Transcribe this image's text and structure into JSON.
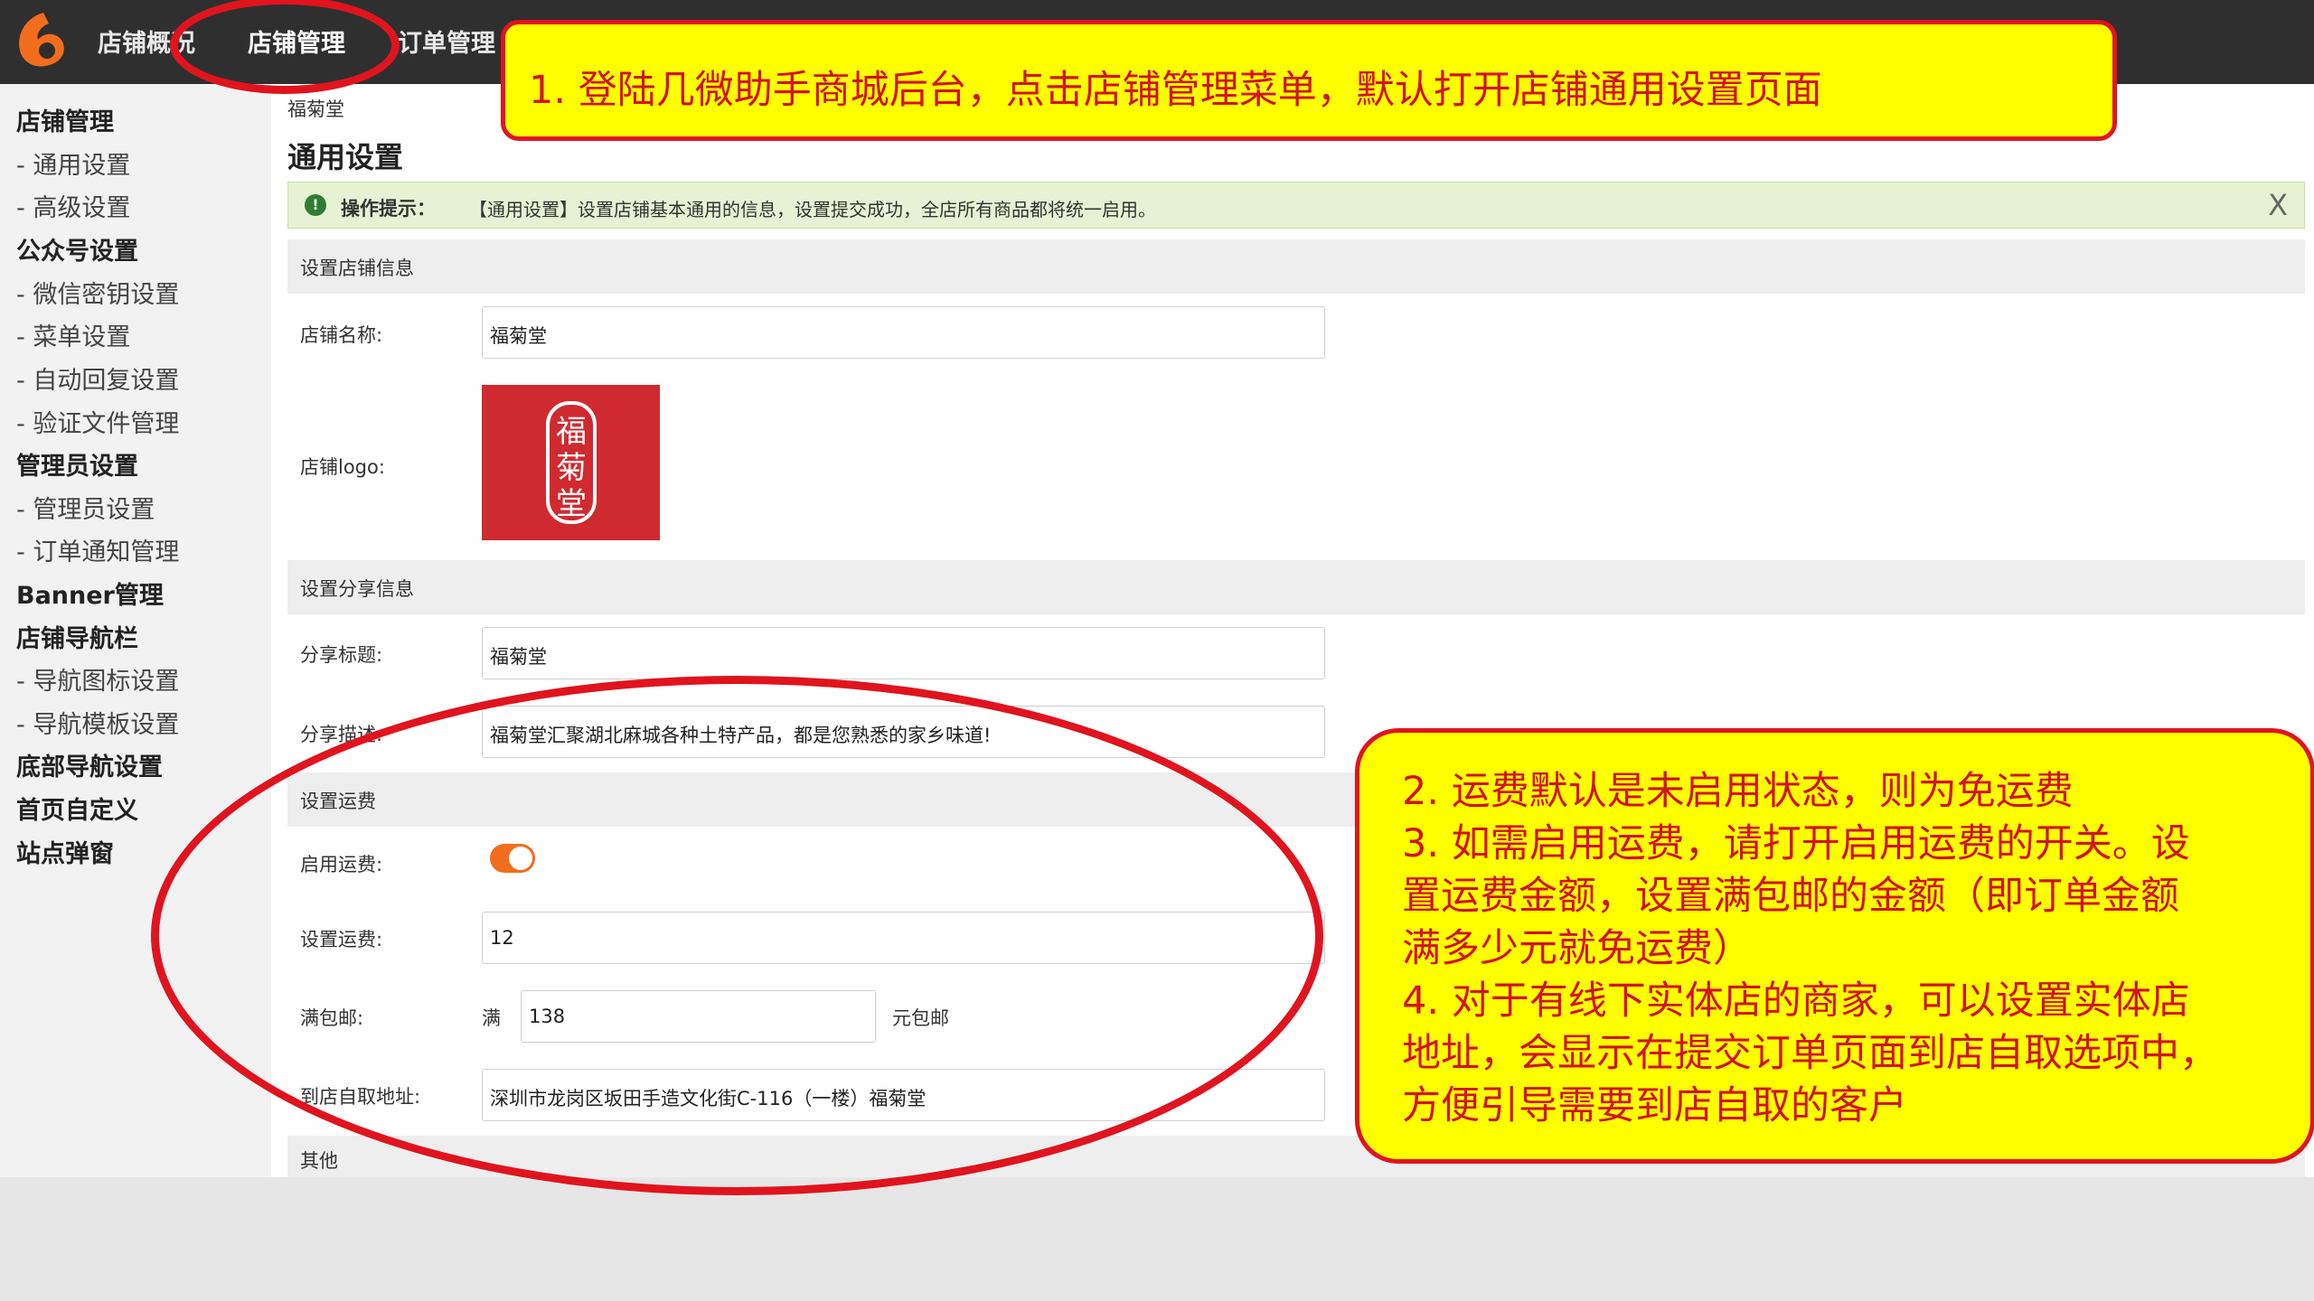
{
  "topnav": {
    "items": [
      "店铺概况",
      "店铺管理",
      "订单管理"
    ],
    "active_index": 1
  },
  "sidebar": {
    "items": [
      {
        "label": "店铺管理",
        "group": true
      },
      {
        "label": "- 通用设置",
        "group": false
      },
      {
        "label": "- 高级设置",
        "group": false
      },
      {
        "label": "公众号设置",
        "group": true
      },
      {
        "label": "- 微信密钥设置",
        "group": false
      },
      {
        "label": "- 菜单设置",
        "group": false
      },
      {
        "label": "- 自动回复设置",
        "group": false
      },
      {
        "label": "- 验证文件管理",
        "group": false
      },
      {
        "label": "管理员设置",
        "group": true
      },
      {
        "label": "- 管理员设置",
        "group": false
      },
      {
        "label": "- 订单通知管理",
        "group": false
      },
      {
        "label": "Banner管理",
        "group": true
      },
      {
        "label": "店铺导航栏",
        "group": true
      },
      {
        "label": "- 导航图标设置",
        "group": false
      },
      {
        "label": "- 导航模板设置",
        "group": false
      },
      {
        "label": "底部导航设置",
        "group": true
      },
      {
        "label": "首页自定义",
        "group": true
      },
      {
        "label": "站点弹窗",
        "group": true
      }
    ]
  },
  "main": {
    "breadcrumb": "福菊堂",
    "title": "通用设置",
    "tip": {
      "label": "操作提示：",
      "text": "【通用设置】设置店铺基本通用的信息，设置提交成功，全店所有商品都将统一启用。",
      "close": "X"
    },
    "sections": {
      "shop_info": "设置店铺信息",
      "share_info": "设置分享信息",
      "shipping": "设置运费",
      "other": "其他"
    },
    "fields": {
      "shop_name_label": "店铺名称:",
      "shop_name_value": "福菊堂",
      "logo_label": "店铺logo:",
      "logo_chars": [
        "福",
        "菊",
        "堂"
      ],
      "share_title_label": "分享标题:",
      "share_title_value": "福菊堂",
      "share_desc_label": "分享描述:",
      "share_desc_value": "福菊堂汇聚湖北麻城各种土特产品，都是您熟悉的家乡味道!",
      "enable_shipping_label": "启用运费:",
      "enable_shipping_on": true,
      "shipping_fee_label": "设置运费:",
      "shipping_fee_value": "12",
      "free_shipping_label": "满包邮:",
      "free_shipping_prefix": "满",
      "free_shipping_value": "138",
      "free_shipping_suffix": "元包邮",
      "pickup_label": "到店自取地址:",
      "pickup_value": "深圳市龙岗区坂田手造文化街C-116（一楼）福菊堂"
    }
  },
  "annotations": {
    "callout1": "1. 登陆几微助手商城后台，点击店铺管理菜单，默认打开店铺通用设置页面",
    "callout2_lines": [
      "2. 运费默认是未启用状态，则为免运费",
      "3. 如需启用运费，请打开启用运费的开关。设",
      "置运费金额，设置满包邮的金额（即订单金额",
      "满多少元就免运费）",
      "4. 对于有线下实体店的商家，可以设置实体店",
      "地址，会显示在提交订单页面到店自取选项中，",
      "方便引导需要到店自取的客户"
    ]
  },
  "colors": {
    "topbar": "#2f2f2f",
    "brand_orange": "#f26d1d",
    "annotation_red": "#e0141e",
    "annotation_yellow": "#ffff00",
    "logo_red": "#cf2a30"
  }
}
